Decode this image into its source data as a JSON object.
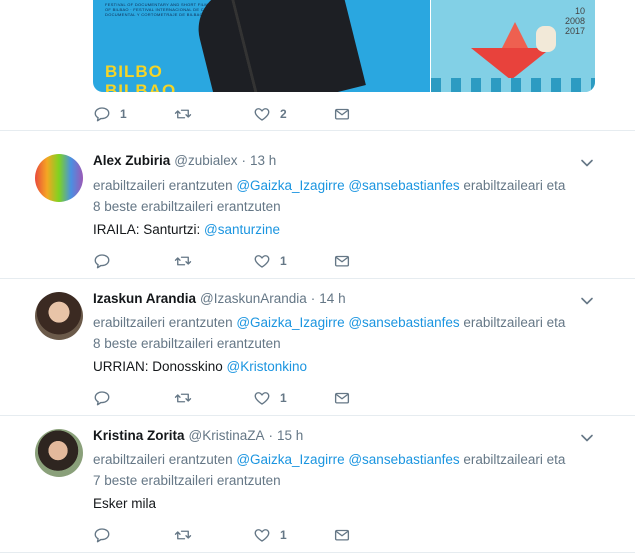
{
  "top_tweet": {
    "media_left_text": "BILBO\nBILBAO",
    "media_left_small": "FESTIVAL OF DOCUMENTARY AND SHORT FILM OF BILBAO · FESTIVAL INTERNACIONAL DE CINE DOCUMENTAL Y CORTOMETRAJE DE BILBAO",
    "media_right_years": "10\n2008\n2017",
    "reply_count": "1",
    "retweet_count": "",
    "like_count": "2"
  },
  "tweets": [
    {
      "fullname": "Alex Zubiria",
      "username": "@zubialex",
      "time": "13 h",
      "replying_prefix": "erabiltzaileri erantzuten ",
      "mention1": "@Gaizka_Izagirre",
      "mention2": "@sansebastianfes",
      "replying_suffix": " erabiltzaileari eta",
      "replying_line2": "8 beste erabiltzaileri erantzuten",
      "text": "IRAILA: Santurtzi: ",
      "text_mention": "@santurzine",
      "reply_count": "",
      "retweet_count": "",
      "like_count": "1"
    },
    {
      "fullname": "Izaskun Arandia",
      "username": "@IzaskunArandia",
      "time": "14 h",
      "replying_prefix": "erabiltzaileri erantzuten ",
      "mention1": "@Gaizka_Izagirre",
      "mention2": "@sansebastianfes",
      "replying_suffix": " erabiltzaileari eta",
      "replying_line2": "8 beste erabiltzaileri erantzuten",
      "text": "URRIAN: Donosskino ",
      "text_mention": "@Kristonkino",
      "reply_count": "",
      "retweet_count": "",
      "like_count": "1"
    },
    {
      "fullname": "Kristina Zorita",
      "username": "@KristinaZA",
      "time": "15 h",
      "replying_prefix": "erabiltzaileri erantzuten ",
      "mention1": "@Gaizka_Izagirre",
      "mention2": "@sansebastianfes",
      "replying_suffix": " erabiltzaileari eta",
      "replying_line2": "7 beste erabiltzaileri erantzuten",
      "text": "Esker mila",
      "text_mention": "",
      "reply_count": "",
      "retweet_count": "",
      "like_count": "1"
    }
  ],
  "separator": "·",
  "colors": {
    "link": "#1b95e0",
    "secondary": "#657786",
    "primary": "#14171a",
    "border": "#e6ecf0"
  },
  "icons": [
    "reply-icon",
    "retweet-icon",
    "like-icon",
    "message-icon",
    "chevron-down-icon"
  ]
}
